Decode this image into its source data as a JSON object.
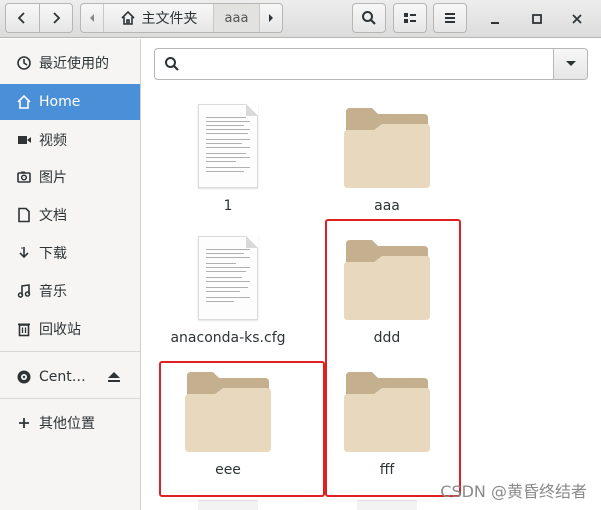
{
  "header": {
    "path_segments": [
      {
        "label": "主文件夹",
        "icon": "home-icon"
      },
      {
        "label": "aaa",
        "icon": null
      }
    ],
    "buttons": [
      "back-icon",
      "forward-icon",
      "search-icon",
      "view-options-icon",
      "menu-icon"
    ],
    "window_controls": [
      "minimize-icon",
      "maximize-icon",
      "close-icon"
    ]
  },
  "sidebar": {
    "items": [
      {
        "label": "最近使用的",
        "icon": "recent-icon"
      },
      {
        "label": "Home",
        "icon": "home-icon",
        "selected": true
      },
      {
        "label": "视频",
        "icon": "video-icon"
      },
      {
        "label": "图片",
        "icon": "camera-icon"
      },
      {
        "label": "文档",
        "icon": "document-icon"
      },
      {
        "label": "下载",
        "icon": "download-icon"
      },
      {
        "label": "音乐",
        "icon": "music-icon"
      },
      {
        "label": "回收站",
        "icon": "trash-icon"
      },
      {
        "label": "Cent…",
        "icon": "disc-icon"
      },
      {
        "label": "其他位置",
        "icon": "plus-icon"
      }
    ]
  },
  "search": {
    "placeholder": ""
  },
  "files": [
    {
      "name": "1",
      "type": "document"
    },
    {
      "name": "aaa",
      "type": "folder"
    },
    {
      "name": "anaconda-ks.cfg",
      "type": "document"
    },
    {
      "name": "ddd",
      "type": "folder"
    },
    {
      "name": "eee",
      "type": "folder"
    },
    {
      "name": "fff",
      "type": "folder"
    }
  ],
  "watermark": "CSDN @黄昏终结者",
  "colors": {
    "accent": "#4a90d9",
    "folder_body": "#e8d8bd",
    "folder_tab": "#c4b08e",
    "highlight": "#e02020"
  }
}
